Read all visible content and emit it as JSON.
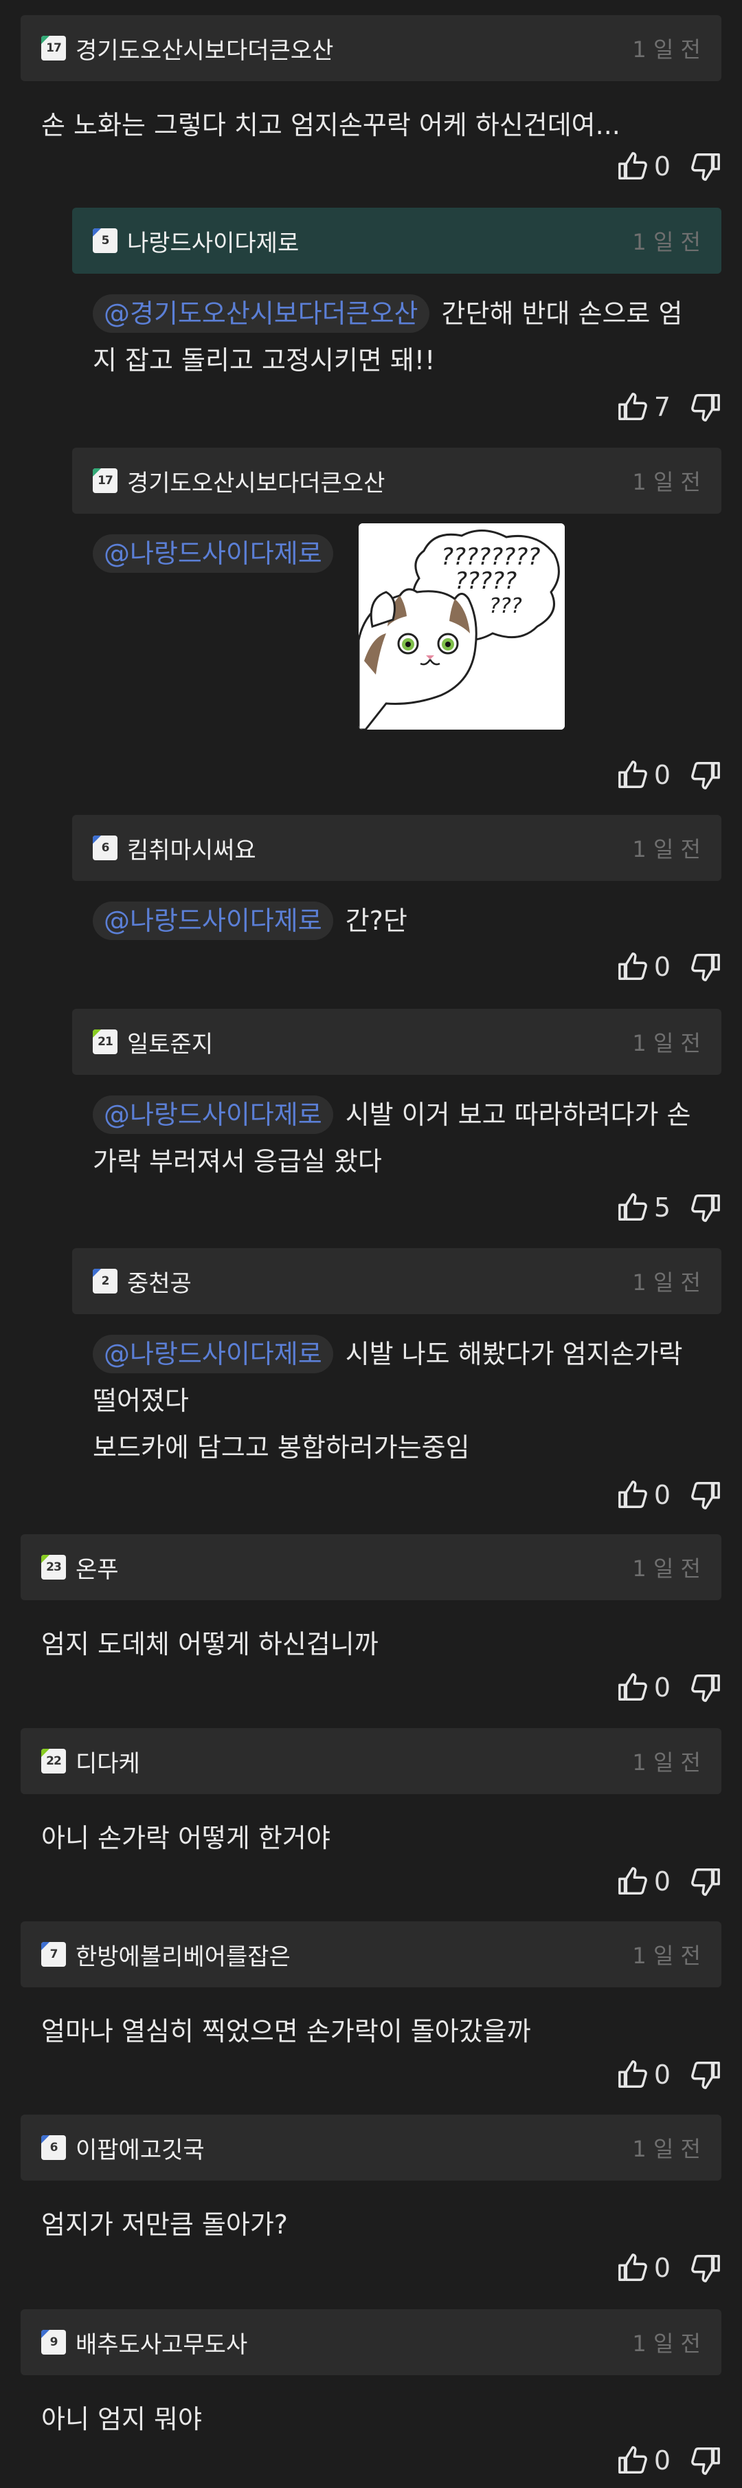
{
  "comments": [
    {
      "nickname": "경기도오산시보다더큰오산",
      "level": "17",
      "level_color": "#33aa77",
      "time": "1 일 전",
      "text": "손 노화는 그렇다 치고 엄지손꾸락 어케 하신건데여...",
      "likes": "0"
    },
    {
      "nickname": "나랑드사이다제로",
      "level": "5",
      "level_color": "#3d6fd1",
      "time": "1 일 전",
      "mention": "@경기도오산시보다더큰오산",
      "text": "간단해 반대 손으로 엄지 잡고 돌리고 고정시키면 돼!!",
      "likes": "7"
    },
    {
      "nickname": "경기도오산시보다더큰오산",
      "level": "17",
      "level_color": "#33aa77",
      "time": "1 일 전",
      "mention": "@나랑드사이다제로",
      "image_text": "????????",
      "likes": "0"
    },
    {
      "nickname": "킴취마시써요",
      "level": "6",
      "level_color": "#3d6fd1",
      "time": "1 일 전",
      "mention": "@나랑드사이다제로",
      "text": "간?단",
      "likes": "0"
    },
    {
      "nickname": "일토준지",
      "level": "21",
      "level_color": "#88cc22",
      "time": "1 일 전",
      "mention": "@나랑드사이다제로",
      "text": "시발 이거 보고 따라하려다가 손가락 부러져서 응급실 왔다",
      "likes": "5"
    },
    {
      "nickname": "중천공",
      "level": "2",
      "level_color": "#3d6fd1",
      "time": "1 일 전",
      "mention": "@나랑드사이다제로",
      "text": "시발 나도 해봤다가 엄지손가락 떨어졌다",
      "text2": "보드카에 담그고 봉합하러가는중임",
      "likes": "0"
    },
    {
      "nickname": "온푸",
      "level": "23",
      "level_color": "#88cc22",
      "time": "1 일 전",
      "text": "엄지 도데체 어떻게 하신겁니까",
      "likes": "0"
    },
    {
      "nickname": "디다케",
      "level": "22",
      "level_color": "#88cc22",
      "time": "1 일 전",
      "text": "아니 손가락 어떻게 한거야",
      "likes": "0"
    },
    {
      "nickname": "한방에볼리베어를잡은",
      "level": "7",
      "level_color": "#3d6fd1",
      "time": "1 일 전",
      "text": "얼마나 열심히 찍었으면 손가락이 돌아갔을까",
      "likes": "0"
    },
    {
      "nickname": "이팝에고깃국",
      "level": "6",
      "level_color": "#3d6fd1",
      "time": "1 일 전",
      "text": "엄지가 저만큼 돌아가?",
      "likes": "0"
    },
    {
      "nickname": "배추도사고무도사",
      "level": "9",
      "level_color": "#3d6fd1",
      "time": "1 일 전",
      "text": "아니 엄지 뭐야",
      "likes": "0"
    }
  ],
  "icons": {
    "like": "thumbs-up-icon",
    "dislike": "thumbs-down-icon"
  },
  "colors": {
    "background": "#1d1d1d",
    "header": "#2c2c2c",
    "header_highlight": "#23403e",
    "mention": "#5b7fd6"
  }
}
